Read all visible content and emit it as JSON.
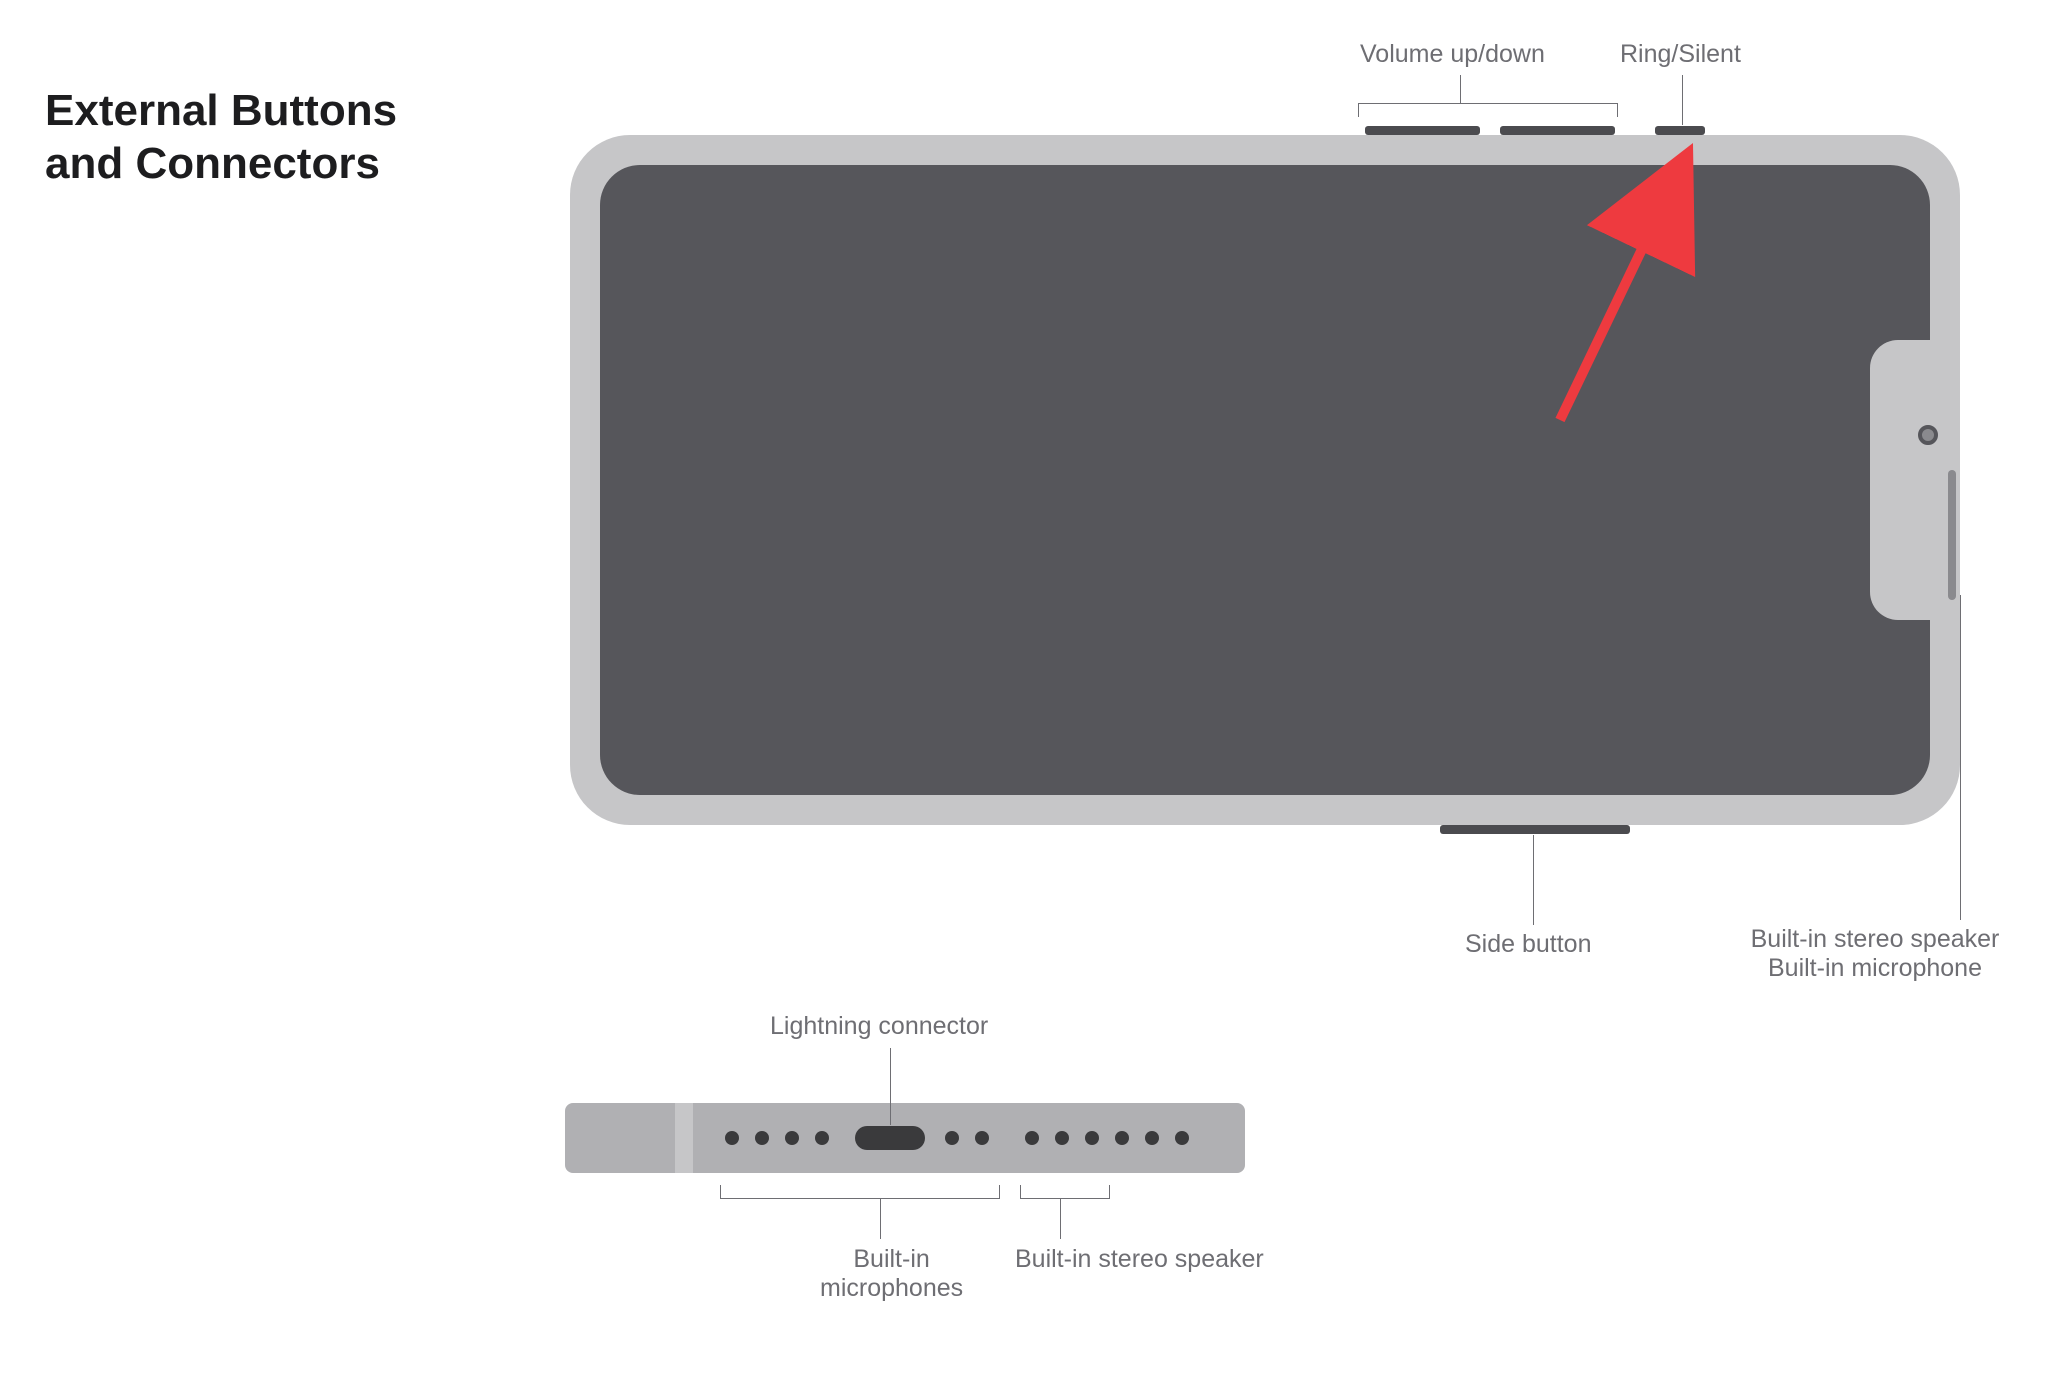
{
  "title": "External Buttons\nand Connectors",
  "labels": {
    "volume": "Volume up/down",
    "ring_silent": "Ring/Silent",
    "side_button": "Side button",
    "speaker_mic": "Built-in stereo speaker\nBuilt-in microphone",
    "lightning": "Lightning connector",
    "builtin_mics": "Built-in\nmicrophones",
    "builtin_speaker": "Built-in stereo speaker"
  },
  "colors": {
    "text": "#1d1d1f",
    "muted": "#6e6e73",
    "body": "#c6c6c8",
    "screen": "#56565b",
    "dark": "#3a3a3c",
    "arrow": "#ee3a3f"
  }
}
